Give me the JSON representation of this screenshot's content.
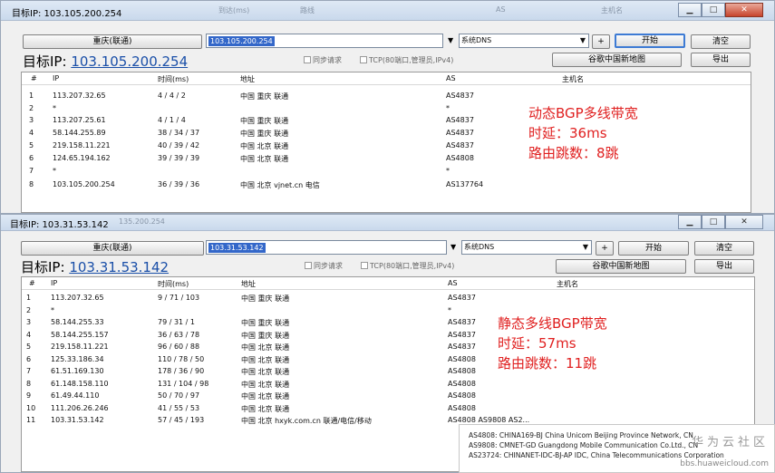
{
  "top": {
    "title": "目标IP: 103.105.200.254",
    "ghost_titles": [
      "到达(ms)",
      "路线",
      "AS",
      "主机名"
    ],
    "win_buttons": [
      "▁",
      "□",
      "✕"
    ],
    "location_button": "重庆(联通)",
    "ip_input_value": "103.105.200.254",
    "dns_combo": "系统DNS",
    "plus_label": "+",
    "start_label": "开始",
    "clear_label": "清空",
    "big_ip_prefix": "目标IP:",
    "big_ip_link": "103.105.200.254",
    "sync_label": "同步请求",
    "tcp_label": "TCP(80端口,管理员,IPv4)",
    "map_button": "谷歌中国新地图",
    "export_button": "导出",
    "headers": [
      "#",
      "IP",
      "时间(ms)",
      "地址",
      "AS",
      "主机名"
    ],
    "rows": [
      [
        "1",
        "113.207.32.65",
        "4 / 4 / 2",
        "中国 重庆 联通",
        "AS4837"
      ],
      [
        "2",
        "*",
        "",
        "",
        "*"
      ],
      [
        "3",
        "113.207.25.61",
        "4 / 1 / 4",
        "中国 重庆 联通",
        "AS4837"
      ],
      [
        "4",
        "58.144.255.89",
        "38 / 34 / 37",
        "中国 重庆 联通",
        "AS4837"
      ],
      [
        "5",
        "219.158.11.221",
        "40 / 39 / 42",
        "中国 北京 联通",
        "AS4837"
      ],
      [
        "6",
        "124.65.194.162",
        "39 / 39 / 39",
        "中国 北京 联通",
        "AS4808"
      ],
      [
        "7",
        "*",
        "",
        "",
        "*"
      ],
      [
        "8",
        "103.105.200.254",
        "36 / 39 / 36",
        "中国 北京 vjnet.cn 电信",
        "AS137764"
      ]
    ],
    "note": [
      "动态BGP多线带宽",
      "时延：36ms",
      "路由跳数：8跳"
    ]
  },
  "bottom": {
    "title": "目标IP: 103.31.53.142",
    "ghost_titles": [
      "135.200.254"
    ],
    "win_buttons": [
      "▁",
      "□",
      "✕"
    ],
    "location_button": "重庆(联通)",
    "ip_input_value": "103.31.53.142",
    "dns_combo": "系统DNS",
    "plus_label": "+",
    "start_label": "开始",
    "clear_label": "清空",
    "big_ip_prefix": "目标IP:",
    "big_ip_link": "103.31.53.142",
    "sync_label": "同步请求",
    "tcp_label": "TCP(80端口,管理员,IPv4)",
    "map_button": "谷歌中国新地图",
    "export_button": "导出",
    "headers": [
      "#",
      "IP",
      "时间(ms)",
      "地址",
      "AS",
      "主机名"
    ],
    "rows": [
      [
        "1",
        "113.207.32.65",
        "9 / 71 / 103",
        "中国 重庆 联通",
        "AS4837"
      ],
      [
        "2",
        "*",
        "",
        "",
        "*"
      ],
      [
        "3",
        "58.144.255.33",
        "79 / 31 / 1",
        "中国 重庆 联通",
        "AS4837"
      ],
      [
        "4",
        "58.144.255.157",
        "36 / 63 / 78",
        "中国 重庆 联通",
        "AS4837"
      ],
      [
        "5",
        "219.158.11.221",
        "96 / 60 / 88",
        "中国 北京 联通",
        "AS4837"
      ],
      [
        "6",
        "125.33.186.34",
        "110 / 78 / 50",
        "中国 北京 联通",
        "AS4808"
      ],
      [
        "7",
        "61.51.169.130",
        "178 / 36 / 90",
        "中国 北京 联通",
        "AS4808"
      ],
      [
        "8",
        "61.148.158.110",
        "131 / 104 / 98",
        "中国 北京 联通",
        "AS4808"
      ],
      [
        "9",
        "61.49.44.110",
        "50 / 70 / 97",
        "中国 北京 联通",
        "AS4808"
      ],
      [
        "10",
        "111.206.26.246",
        "41 / 55 / 53",
        "中国 北京 联通",
        "AS4808"
      ],
      [
        "11",
        "103.31.53.142",
        "57 / 45 / 193",
        "中国 北京 hxyk.com.cn 联通/电信/移动",
        "AS4808 AS9808 AS2..."
      ]
    ],
    "note": [
      "静态多线BGP带宽",
      "时延：57ms",
      "路由跳数：11跳"
    ],
    "tooltip": [
      "AS4808: CHINA169-BJ China Unicom Beijing Province Network, CN",
      "AS9808: CMNET-GD Guangdong Mobile Communication Co.Ltd., CN",
      "AS23724: CHINANET-IDC-BJ-AP IDC, China Telecommunications Corporation"
    ],
    "watermark_text": "华为云社区",
    "watermark_url": "bbs.huaweicloud.com"
  }
}
